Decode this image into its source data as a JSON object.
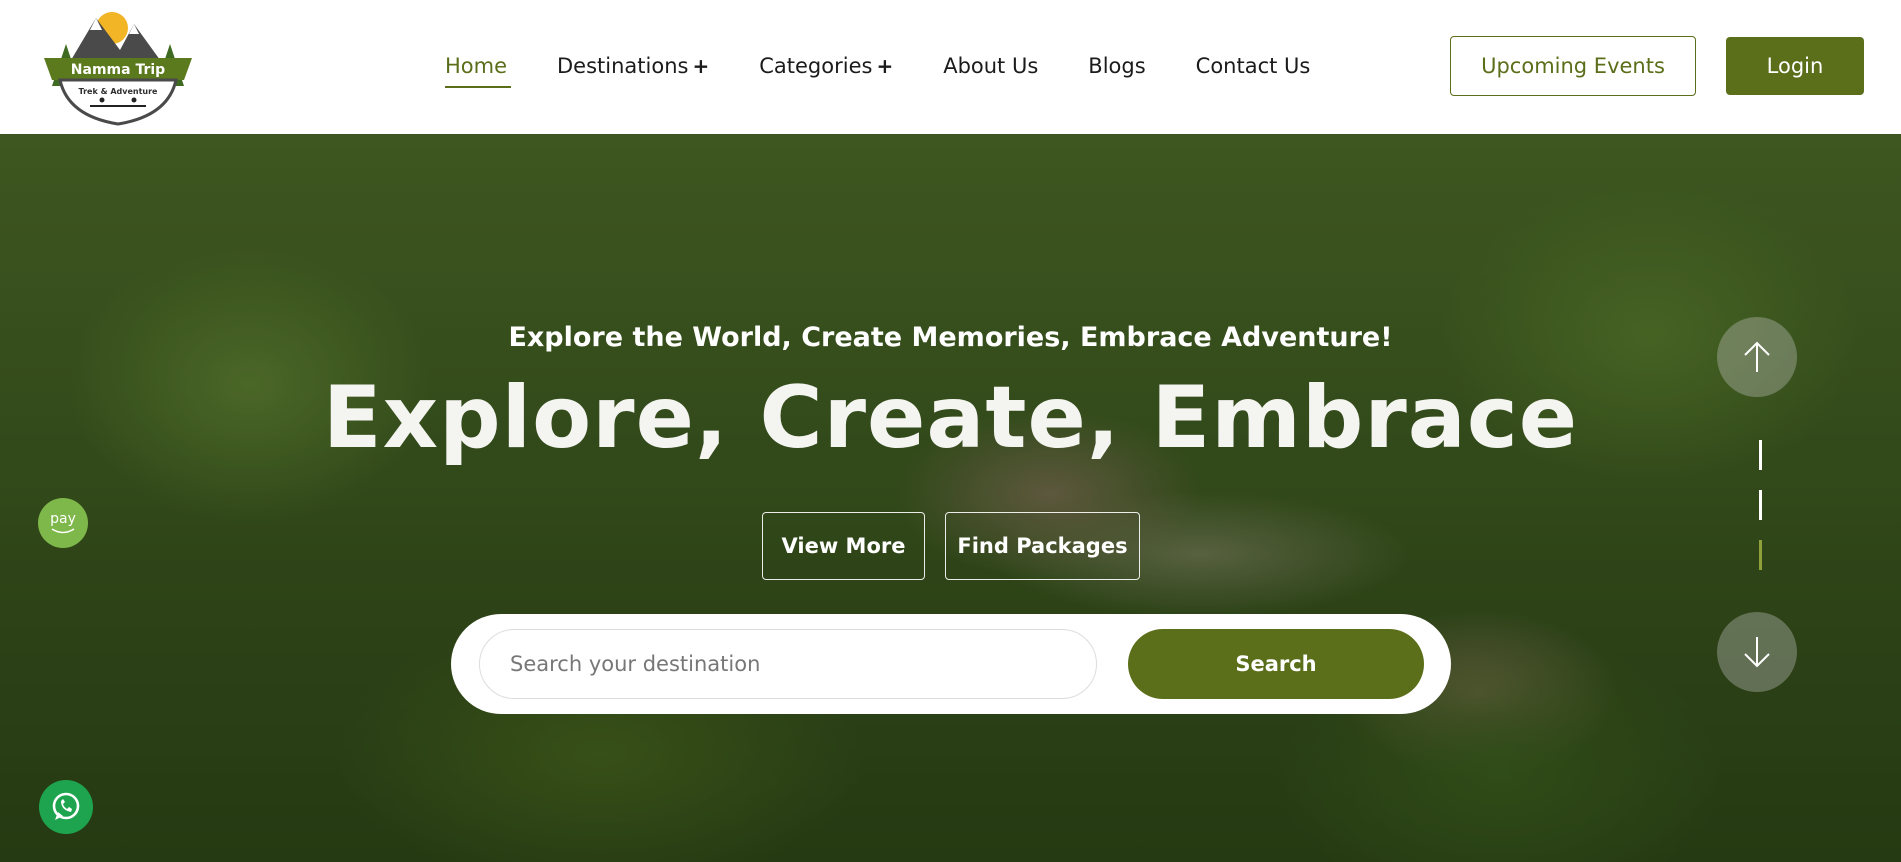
{
  "brand": {
    "name": "Namma Trip",
    "tagline": "Trek & Adventure",
    "accent_color": "#5b6e1a"
  },
  "nav": {
    "items": [
      {
        "label": "Home",
        "active": true
      },
      {
        "label": "Destinations",
        "has_submenu": true
      },
      {
        "label": "Categories",
        "has_submenu": true
      },
      {
        "label": "About Us"
      },
      {
        "label": "Blogs"
      },
      {
        "label": "Contact Us"
      }
    ],
    "submenu_glyph": "+"
  },
  "header_actions": {
    "upcoming_events_label": "Upcoming Events",
    "login_label": "Login"
  },
  "hero": {
    "tagline": "Explore the World, Create Memories, Embrace Adventure!",
    "headline": "Explore, Create, Embrace",
    "view_more_label": "View More",
    "find_packages_label": "Find Packages"
  },
  "search": {
    "placeholder": "Search your destination",
    "value": "",
    "button_label": "Search"
  },
  "slider": {
    "up_icon": "arrow-up-icon",
    "down_icon": "arrow-down-icon",
    "active_index": 3,
    "total": 3
  },
  "floating": {
    "amazon_pay_label": "pay",
    "whatsapp_icon": "whatsapp-icon"
  }
}
